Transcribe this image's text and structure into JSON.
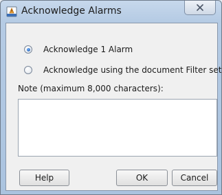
{
  "window": {
    "title": "Acknowledge Alarms",
    "app_icon": "document-alarm-icon",
    "close_icon": "close-icon"
  },
  "options": [
    {
      "label": "Acknowledge 1 Alarm",
      "checked": true
    },
    {
      "label": "Acknowledge using the document Filter settings",
      "checked": false
    }
  ],
  "note": {
    "label": "Note (maximum 8,000 characters):",
    "value": ""
  },
  "buttons": {
    "help": "Help",
    "ok": "OK",
    "cancel": "Cancel"
  }
}
